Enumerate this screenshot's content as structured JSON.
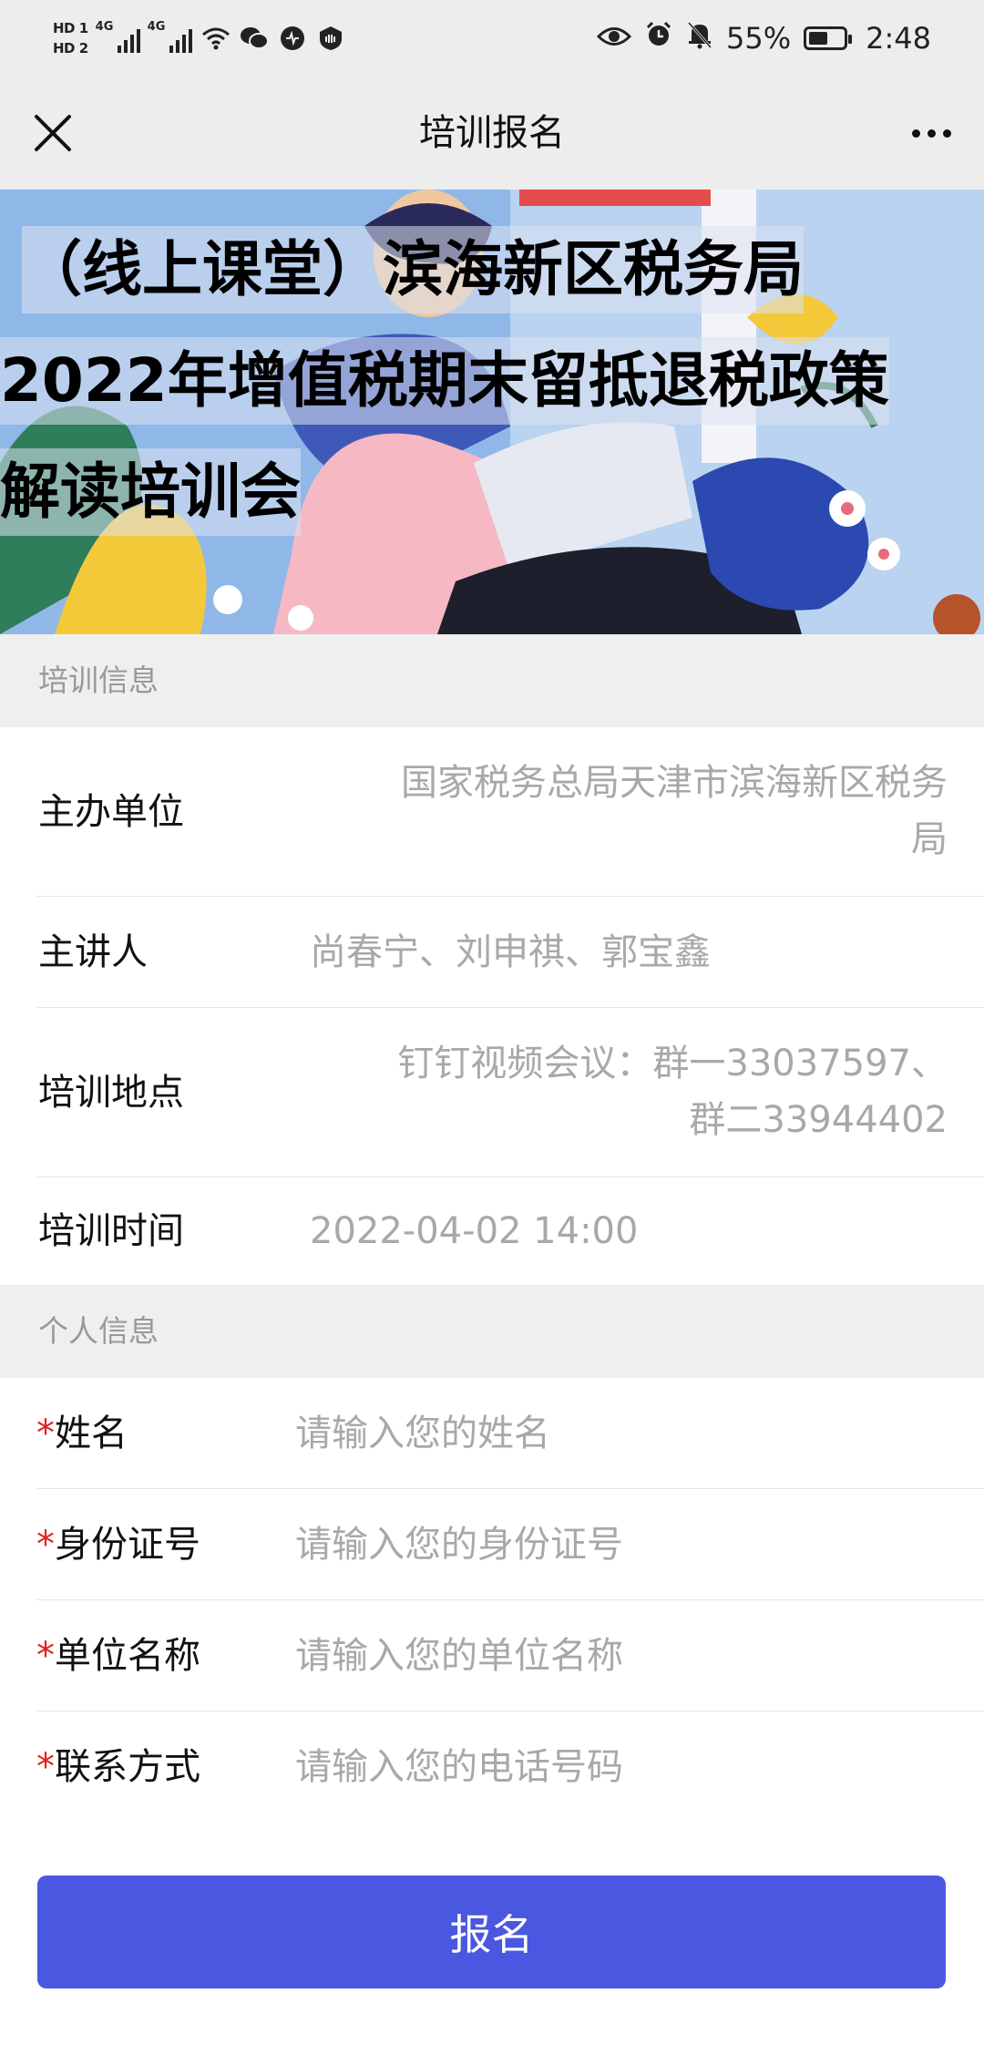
{
  "status_bar": {
    "hd1": "HD 1",
    "hd2": "HD 2",
    "signal1": "4G",
    "signal2": "4G",
    "battery_percent": "55%",
    "battery_level": 0.55,
    "time": "2:48",
    "icons": [
      "signal-icon",
      "wifi-icon",
      "wechat-icon",
      "app-icon",
      "shield-icon",
      "eye-icon",
      "alarm-icon",
      "mute-bell-icon",
      "battery-icon"
    ]
  },
  "title_bar": {
    "title": "培训报名",
    "close_icon": "close-icon",
    "more_icon": "more-icon"
  },
  "banner": {
    "line1": "（线上课堂）滨海新区税务局",
    "line2": "2022年增值税期末留抵退税政策",
    "line3": "解读培训会"
  },
  "training_info": {
    "section_title": "培训信息",
    "rows": [
      {
        "label": "主办单位",
        "value_line1": "国家税务总局天津市滨海新区税务",
        "value_line2": "局"
      },
      {
        "label": "主讲人",
        "value": "尚春宁、刘申祺、郭宝鑫"
      },
      {
        "label": "培训地点",
        "value_line1": "钉钉视频会议：群一33037597、",
        "value_line2": "群二33944402"
      },
      {
        "label": "培训时间",
        "value": "2022-04-02 14:00"
      }
    ]
  },
  "personal_info": {
    "section_title": "个人信息",
    "required_mark": "*",
    "fields": [
      {
        "label": "姓名",
        "placeholder": "请输入您的姓名",
        "value": ""
      },
      {
        "label": "身份证号",
        "placeholder": "请输入您的身份证号",
        "value": ""
      },
      {
        "label": "单位名称",
        "placeholder": "请输入您的单位名称",
        "value": ""
      },
      {
        "label": "联系方式",
        "placeholder": "请输入您的电话号码",
        "value": ""
      }
    ]
  },
  "submit_label": "报名",
  "colors": {
    "accent": "#4a57e0",
    "required": "#e02020",
    "placeholder": "#a8a8a8",
    "section_bg": "#efefef"
  }
}
